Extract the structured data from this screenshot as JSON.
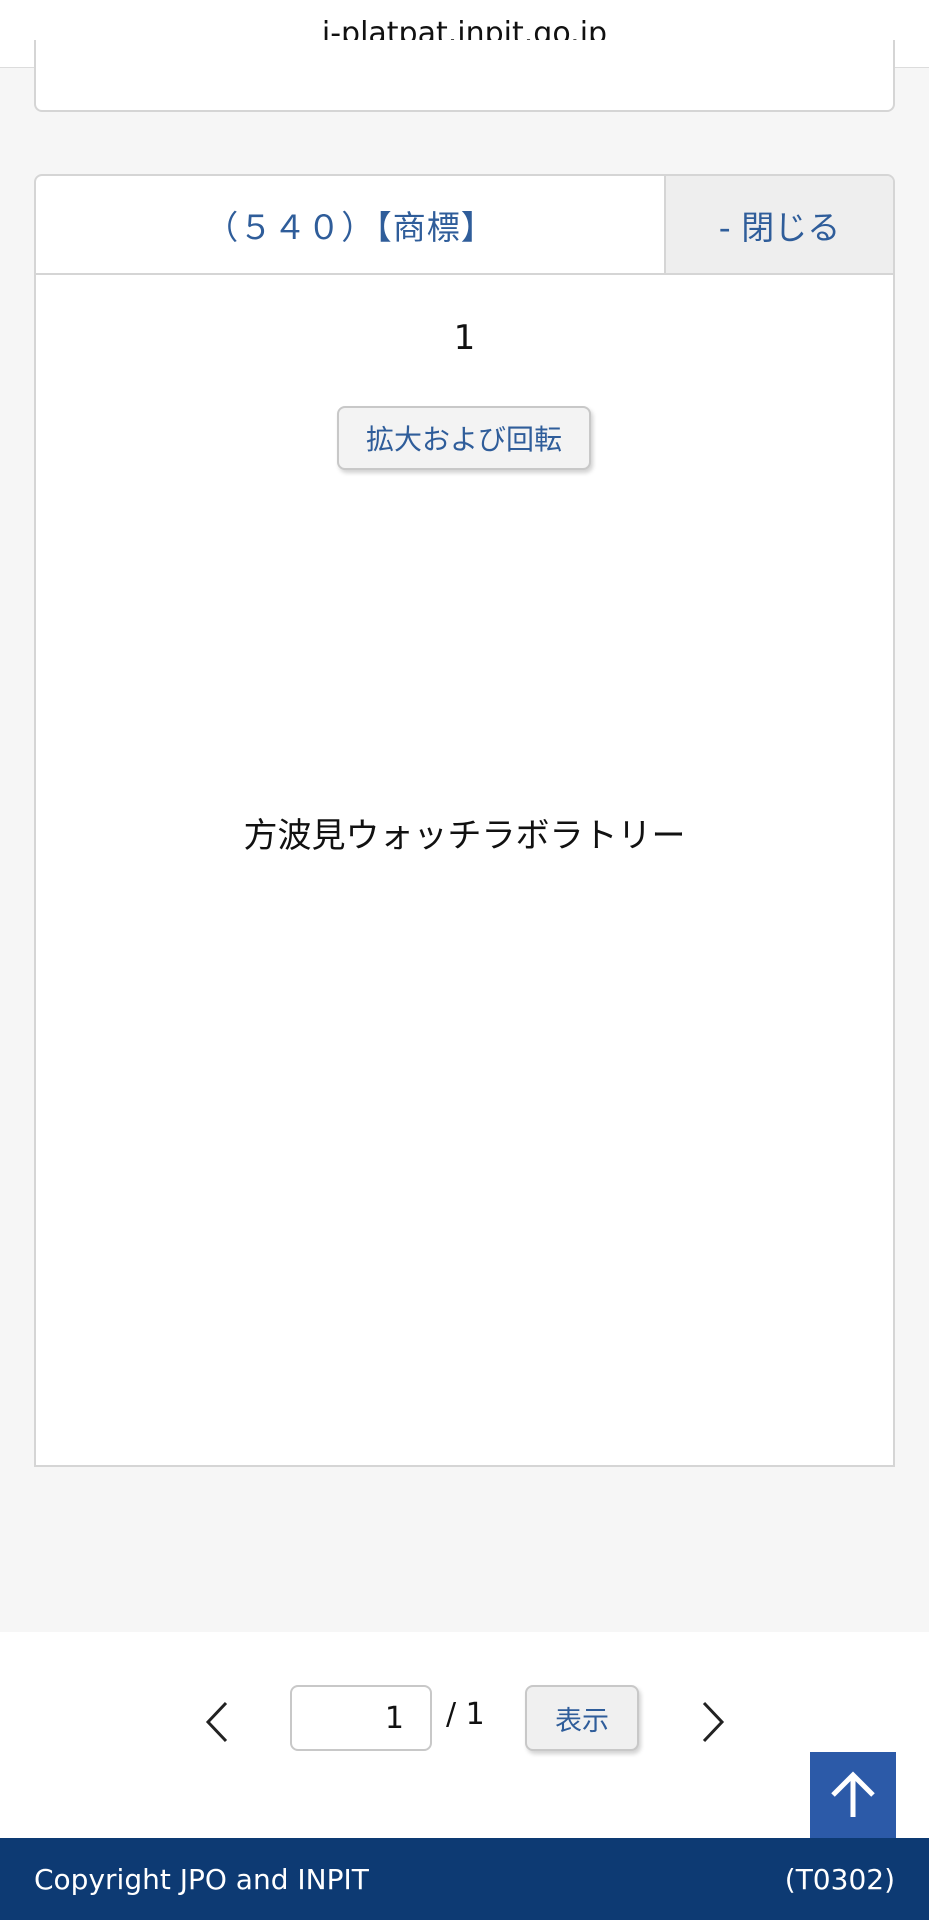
{
  "browser": {
    "url": "j-platpat.inpit.go.jp"
  },
  "panel": {
    "title": "（５４０）【商標】",
    "close_label": "- 閉じる",
    "page_number": "1",
    "zoom_rotate_label": "拡大および回転",
    "mark_text": "方波見ウォッチラボラトリー"
  },
  "pager": {
    "current_page": "1",
    "total_label": "/ 1",
    "show_label": "表示",
    "prev_icon": "chevron-left-icon",
    "next_icon": "chevron-right-icon"
  },
  "back_to_top": {
    "icon": "arrow-up-icon"
  },
  "footer": {
    "copyright": "Copyright JPO and INPIT",
    "page_code": "(T0302)"
  },
  "colors": {
    "link_blue": "#2f5d9a",
    "footer_bg": "#0d3a73",
    "top_button_bg": "#2c5aa8",
    "page_bg": "#f6f6f6"
  }
}
